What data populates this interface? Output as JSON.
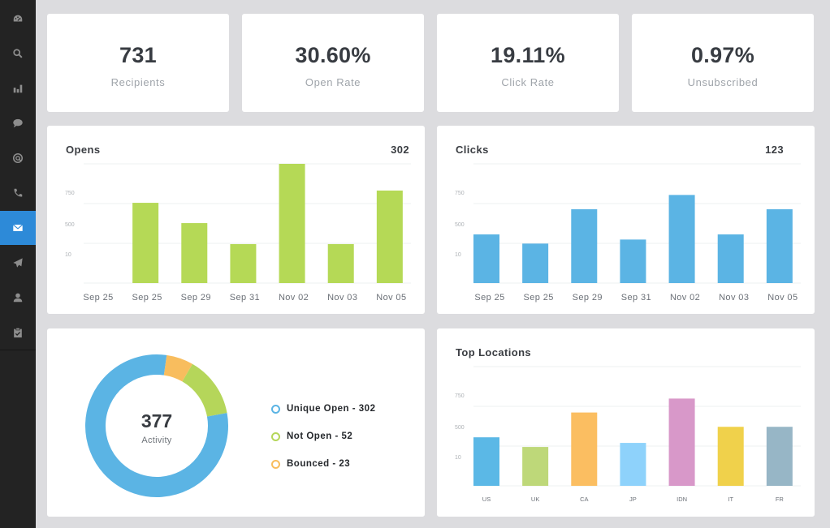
{
  "sidebar": {
    "items": [
      {
        "icon": "dashboard-icon",
        "active": false
      },
      {
        "icon": "search-icon",
        "active": false
      },
      {
        "icon": "bar-chart-icon",
        "active": false
      },
      {
        "icon": "chat-bubble-icon",
        "active": false
      },
      {
        "icon": "at-target-icon",
        "active": false
      },
      {
        "icon": "phone-icon",
        "active": false
      },
      {
        "icon": "envelope-icon",
        "active": true
      },
      {
        "icon": "paper-plane-icon",
        "active": false
      },
      {
        "icon": "user-icon",
        "active": false
      },
      {
        "icon": "clipboard-check-icon",
        "active": false
      }
    ],
    "active_color": "#2d8ad8"
  },
  "stats": [
    {
      "value": "731",
      "label": "Recipients"
    },
    {
      "value": "30.60%",
      "label": "Open Rate"
    },
    {
      "value": "19.11%",
      "label": "Click Rate"
    },
    {
      "value": "0.97%",
      "label": "Unsubscribed"
    }
  ],
  "opens": {
    "title": "Opens",
    "total": "302"
  },
  "clicks": {
    "title": "Clicks",
    "total": "123"
  },
  "activity": {
    "value": "377",
    "label": "Activity"
  },
  "locations": {
    "title": "Top Locations"
  },
  "legend": [
    {
      "label": "Unique Open - 302",
      "color": "#5bb4e4"
    },
    {
      "label": "Not Open - 52",
      "color": "#b5d65a"
    },
    {
      "label": "Bounced - 23",
      "color": "#f8bd5e"
    }
  ],
  "chart_data": [
    {
      "type": "bar",
      "title": "Opens",
      "categories": [
        "Sep 25",
        "Sep 25",
        "Sep 29",
        "Sep 31",
        "Nov 02",
        "Nov 03",
        "Nov 05"
      ],
      "values": [
        0,
        673,
        503,
        327,
        1000,
        327,
        776
      ],
      "ytick_labels": [
        "750",
        "500",
        "10"
      ],
      "ylim": [
        0,
        1000
      ],
      "grid": true,
      "color": "#b5d956"
    },
    {
      "type": "bar",
      "title": "Clicks",
      "categories": [
        "Sep 25",
        "Sep 25",
        "Sep 29",
        "Sep 31",
        "Nov 02",
        "Nov 03",
        "Nov 05"
      ],
      "values": [
        408,
        331,
        619,
        365,
        739,
        408,
        619
      ],
      "ytick_labels": [
        "750",
        "500",
        "10"
      ],
      "ylim": [
        0,
        1000
      ],
      "grid": true,
      "color": "#5bb4e4"
    },
    {
      "type": "pie",
      "title": "Activity",
      "labels": [
        "Unique Open",
        "Not Open",
        "Bounced"
      ],
      "values": [
        302,
        52,
        23
      ],
      "colors": [
        "#5bb4e4",
        "#b5d65a",
        "#f8bd5e"
      ],
      "center_text": "377"
    },
    {
      "type": "bar",
      "title": "Top Locations",
      "categories": [
        "US",
        "UK",
        "CA",
        "JP",
        "IDN",
        "IT",
        "FR"
      ],
      "values": [
        407,
        326,
        615,
        360,
        732,
        495,
        495
      ],
      "ytick_labels": [
        "750",
        "500",
        "10"
      ],
      "ylim": [
        0,
        1000
      ],
      "grid": true,
      "colors": [
        "#5bb8e6",
        "#bed879",
        "#fbbe61",
        "#8ed2fb",
        "#d898c9",
        "#f0d14b",
        "#97b6c6"
      ]
    }
  ]
}
